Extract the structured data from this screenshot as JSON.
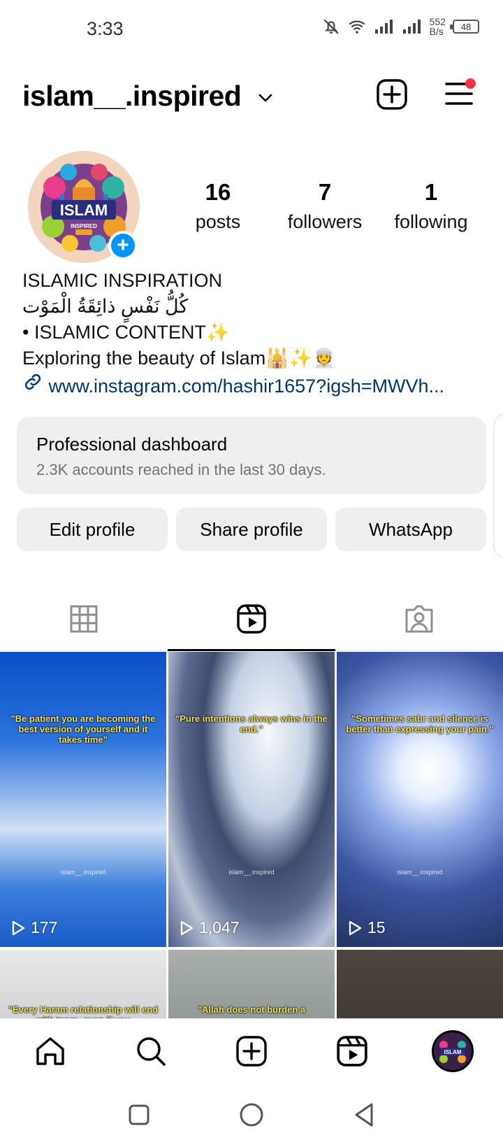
{
  "status_bar": {
    "time": "3:33",
    "net_speed_value": "552",
    "net_speed_unit": "B/s",
    "battery": "48"
  },
  "header": {
    "username": "islam__.inspired"
  },
  "profile": {
    "stats": {
      "posts_count": "16",
      "posts_label": "posts",
      "followers_count": "7",
      "followers_label": "followers",
      "following_count": "1",
      "following_label": "following"
    },
    "bio": {
      "name": "ISLAMIC INSPIRATION",
      "arabic": "كُلُّ نَفْسٍ ذائِقَةُ الْمَوْت",
      "line1": "• ISLAMIC CONTENT✨",
      "line2": "Exploring the beauty of Islam🕌✨👳",
      "link": "www.instagram.com/hashir1657?igsh=MWVh..."
    },
    "avatar_logo_text": "ISLAM",
    "avatar_logo_subtext": "INSPIRED"
  },
  "dashboard": {
    "title": "Professional dashboard",
    "subtitle": "2.3K accounts reached in the last 30 days."
  },
  "buttons": {
    "edit": "Edit profile",
    "share": "Share profile",
    "whatsapp": "WhatsApp"
  },
  "tabs": {
    "active": "reels"
  },
  "reels": [
    {
      "caption": "\"Be patient you are becoming the best version of yourself and it takes time\"",
      "watermark": "islam__.inspired",
      "views": "177"
    },
    {
      "caption": "\"Pure intentions always wins in the end.\"",
      "watermark": "islam__.inspired",
      "views": "1,047"
    },
    {
      "caption": "\"Sometimes sabr and silence is better than expressing your pain.\"",
      "watermark": "islam__.inspired",
      "views": "15"
    },
    {
      "caption": "\"Every Haram relationship will end with tears, even if you",
      "watermark": "",
      "views": ""
    },
    {
      "caption": "\"Allah does not burden a",
      "watermark": "",
      "views": ""
    },
    {
      "caption": "",
      "watermark": "",
      "views": ""
    }
  ],
  "colors": {
    "accent_blue": "#0095f6",
    "link_blue": "#00376b",
    "notification_red": "#ff3040",
    "button_gray": "#efefef",
    "caption_yellow": "#f4e05b"
  },
  "icons": [
    "chevron-down-icon",
    "add-post-icon",
    "menu-icon",
    "grid-icon",
    "reels-icon",
    "tagged-icon",
    "link-icon",
    "home-icon",
    "search-icon",
    "create-icon",
    "reels-nav-icon",
    "square-icon",
    "circle-icon",
    "back-icon"
  ]
}
